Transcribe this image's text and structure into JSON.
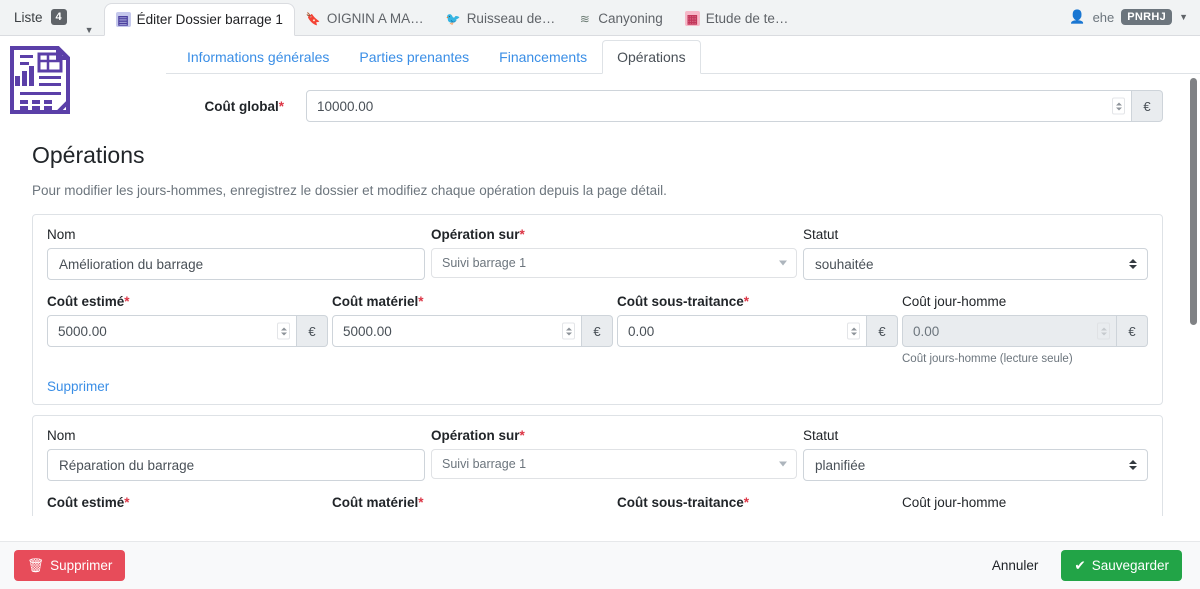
{
  "browser": {
    "tab_group": {
      "label": "Liste",
      "count": "4",
      "caret": "chevron-down-icon"
    },
    "tabs": [
      {
        "label": "Éditer Dossier barrage 1",
        "favicon": "document-favicon",
        "glyph": "≡",
        "active": true
      },
      {
        "label": "OIGNIN A MA…",
        "favicon": "bulb-favicon",
        "glyph": "⚈",
        "active": false
      },
      {
        "label": "Ruisseau de…",
        "favicon": "bird-favicon",
        "glyph": "❦",
        "active": false
      },
      {
        "label": "Canyoning",
        "favicon": "wave-favicon",
        "glyph": "≋",
        "active": false
      },
      {
        "label": "Etude de te…",
        "favicon": "chart-favicon",
        "glyph": "▐",
        "active": false
      }
    ],
    "user": {
      "name": "ehe",
      "badge": "PNRHJ",
      "icon": "person-icon",
      "caret": "chevron-down-icon"
    }
  },
  "app": {
    "logo": "report-document-icon",
    "nav_tabs": [
      {
        "label": "Informations générales",
        "active": false
      },
      {
        "label": "Parties prenantes",
        "active": false
      },
      {
        "label": "Financements",
        "active": false
      },
      {
        "label": "Opérations",
        "active": true
      }
    ],
    "global_cost": {
      "label": "Coût global",
      "required_mark": "*",
      "value": "10000.00",
      "suffix": "€"
    },
    "section": {
      "title": "Opérations",
      "description": "Pour modifier les jours-hommes, enregistrez le dossier et modifiez chaque opération depuis la page détail."
    },
    "labels": {
      "nom": "Nom",
      "operation_sur": "Opération sur",
      "statut": "Statut",
      "cout_estime": "Coût estimé",
      "cout_materiel": "Coût matériel",
      "cout_sous_traitance": "Coût sous-traitance",
      "cout_jour_homme": "Coût jour-homme",
      "required_mark": "*",
      "jour_homme_hint": "Coût jours-homme (lecture seule)",
      "delete_link": "Supprimer",
      "currency": "€"
    },
    "operations": [
      {
        "nom": "Amélioration du barrage",
        "operation_sur": "Suivi barrage 1",
        "statut": "souhaitée",
        "cout_estime": "5000.00",
        "cout_materiel": "5000.00",
        "cout_sous_traitance": "0.00",
        "cout_jour_homme": "0.00"
      },
      {
        "nom": "Réparation du barrage",
        "operation_sur": "Suivi barrage 1",
        "statut": "planifiée",
        "cout_estime": "",
        "cout_materiel": "",
        "cout_sous_traitance": "",
        "cout_jour_homme": ""
      }
    ],
    "footer": {
      "delete_label": "Supprimer",
      "delete_icon": "trash-icon",
      "cancel_label": "Annuler",
      "save_label": "Sauvegarder",
      "save_icon": "check-circle-icon"
    }
  },
  "colors": {
    "link": "#3a8ee6",
    "danger": "#e74c5a",
    "success": "#22a447",
    "required": "#dc3545",
    "logo": "#5b3fa8"
  }
}
